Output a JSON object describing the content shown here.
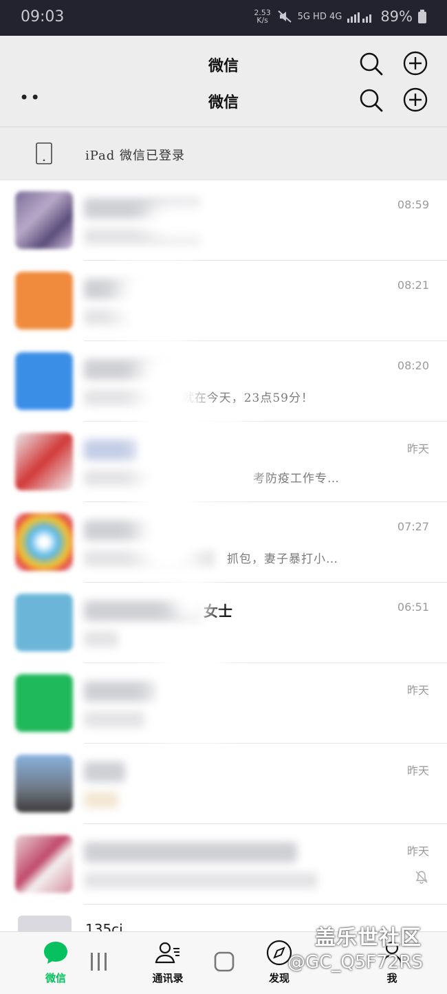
{
  "status_bar": {
    "time": "09:03",
    "net_speed": "2.53 K/s",
    "indicators": "5G HD 4G",
    "battery": "89%"
  },
  "header": {
    "title": "微信",
    "title_repeat": "微信",
    "more_label": "••"
  },
  "device_bar": {
    "label": "iPad 微信已登录"
  },
  "chats": [
    {
      "time": "08:59",
      "name_tail": "",
      "preview": "",
      "muted": false
    },
    {
      "time": "08:21",
      "name_tail": "",
      "preview": "知",
      "muted": false
    },
    {
      "time": "08:20",
      "name_tail": "",
      "preview": ":就在今天，23点59分！",
      "muted": false
    },
    {
      "time": "昨天",
      "name_tail": "",
      "preview": "考防疫工作专…",
      "muted": false
    },
    {
      "time": "07:27",
      "name_tail": "",
      "preview": "抓包，妻子暴打小…",
      "muted": false
    },
    {
      "time": "06:51",
      "name_tail": "女士",
      "preview": "",
      "muted": false
    },
    {
      "time": "昨天",
      "name_tail": "",
      "preview": "",
      "muted": false
    },
    {
      "time": "昨天",
      "name_tail": "",
      "preview": "",
      "muted": false
    },
    {
      "time": "昨天",
      "name_tail": "",
      "preview": "",
      "muted": true
    }
  ],
  "partial_row": {
    "text": "135ci..."
  },
  "tabs": [
    {
      "label": "微信",
      "icon": "chat-bubble-icon",
      "active": true
    },
    {
      "label": "通讯录",
      "icon": "contacts-icon",
      "active": false
    },
    {
      "label": "发现",
      "icon": "compass-icon",
      "active": false
    },
    {
      "label": "我",
      "icon": "person-icon",
      "active": false
    }
  ],
  "watermark": {
    "line1": "盖乐世社区",
    "line2": "@GC_Q5F72RS"
  },
  "colors": {
    "accent": "#07c160",
    "status_bar": "#22232e",
    "header_bg": "#ededed"
  }
}
